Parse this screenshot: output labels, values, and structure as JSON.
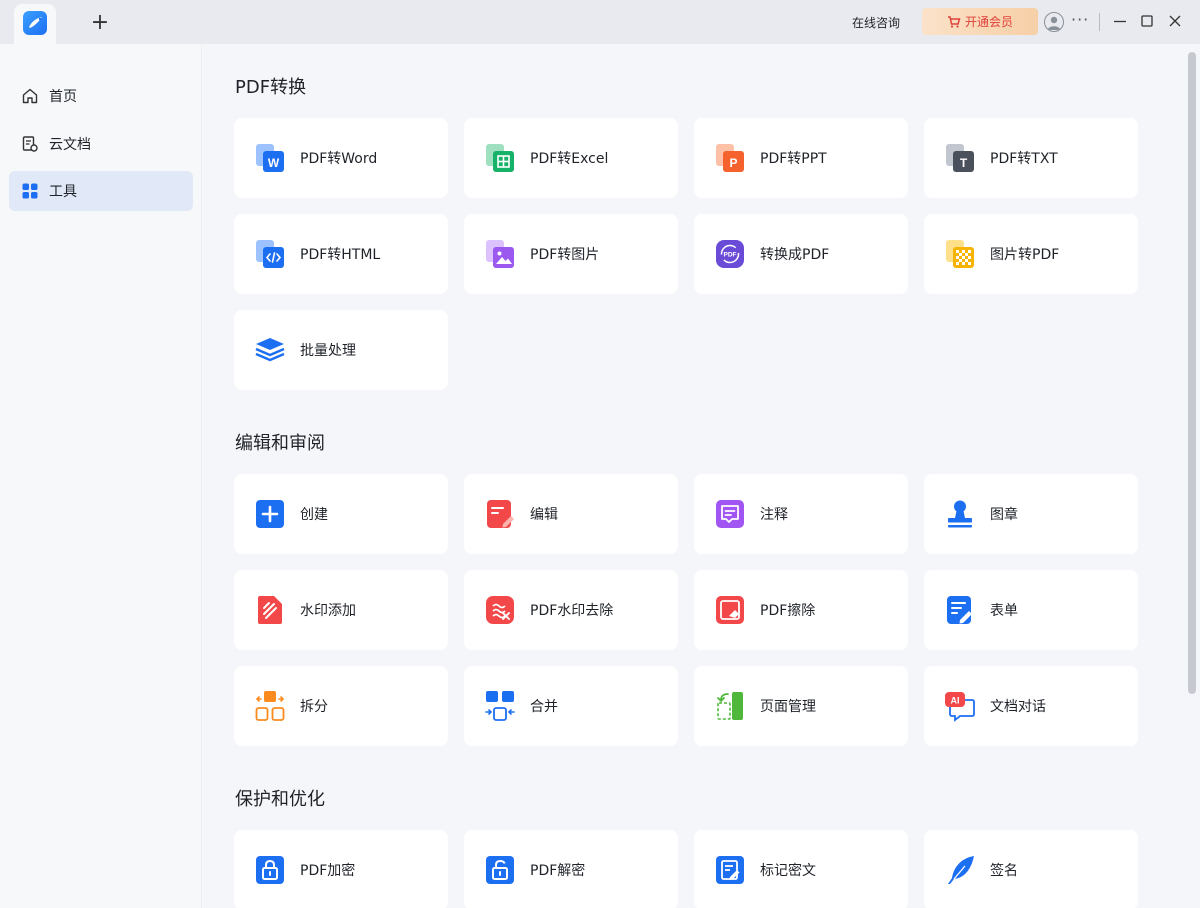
{
  "titlebar": {
    "new_tab_glyph": "+",
    "consult_label": "在线咨询",
    "vip_label": "开通会员",
    "more_glyph": "···"
  },
  "sidebar": {
    "items": [
      {
        "label": "首页",
        "icon": "home-icon"
      },
      {
        "label": "云文档",
        "icon": "cloud-doc-icon"
      },
      {
        "label": "工具",
        "icon": "tools-icon",
        "active": true
      }
    ]
  },
  "sections": [
    {
      "title": "PDF转换",
      "tools": [
        {
          "label": "PDF转Word",
          "icon": "word-icon"
        },
        {
          "label": "PDF转Excel",
          "icon": "excel-icon"
        },
        {
          "label": "PDF转PPT",
          "icon": "ppt-icon"
        },
        {
          "label": "PDF转TXT",
          "icon": "txt-icon"
        },
        {
          "label": "PDF转HTML",
          "icon": "html-icon"
        },
        {
          "label": "PDF转图片",
          "icon": "image-icon"
        },
        {
          "label": "转换成PDF",
          "icon": "to-pdf-icon"
        },
        {
          "label": "图片转PDF",
          "icon": "image-to-pdf-icon"
        },
        {
          "label": "批量处理",
          "icon": "batch-icon"
        }
      ]
    },
    {
      "title": "编辑和审阅",
      "tools": [
        {
          "label": "创建",
          "icon": "create-icon"
        },
        {
          "label": "编辑",
          "icon": "edit-icon"
        },
        {
          "label": "注释",
          "icon": "comment-icon"
        },
        {
          "label": "图章",
          "icon": "stamp-icon"
        },
        {
          "label": "水印添加",
          "icon": "watermark-add-icon"
        },
        {
          "label": "PDF水印去除",
          "icon": "watermark-remove-icon"
        },
        {
          "label": "PDF擦除",
          "icon": "erase-icon"
        },
        {
          "label": "表单",
          "icon": "form-icon"
        },
        {
          "label": "拆分",
          "icon": "split-icon"
        },
        {
          "label": "合并",
          "icon": "merge-icon"
        },
        {
          "label": "页面管理",
          "icon": "page-manage-icon"
        },
        {
          "label": "文档对话",
          "icon": "ai-chat-icon"
        }
      ]
    },
    {
      "title": "保护和优化",
      "tools": [
        {
          "label": "PDF加密",
          "icon": "lock-icon"
        },
        {
          "label": "PDF解密",
          "icon": "unlock-icon"
        },
        {
          "label": "标记密文",
          "icon": "redact-icon"
        },
        {
          "label": "签名",
          "icon": "signature-icon"
        }
      ]
    }
  ],
  "colors": {
    "accent": "#1d6ff2",
    "active_nav_bg": "#e1e9f8",
    "vip_text": "#e0403a"
  }
}
